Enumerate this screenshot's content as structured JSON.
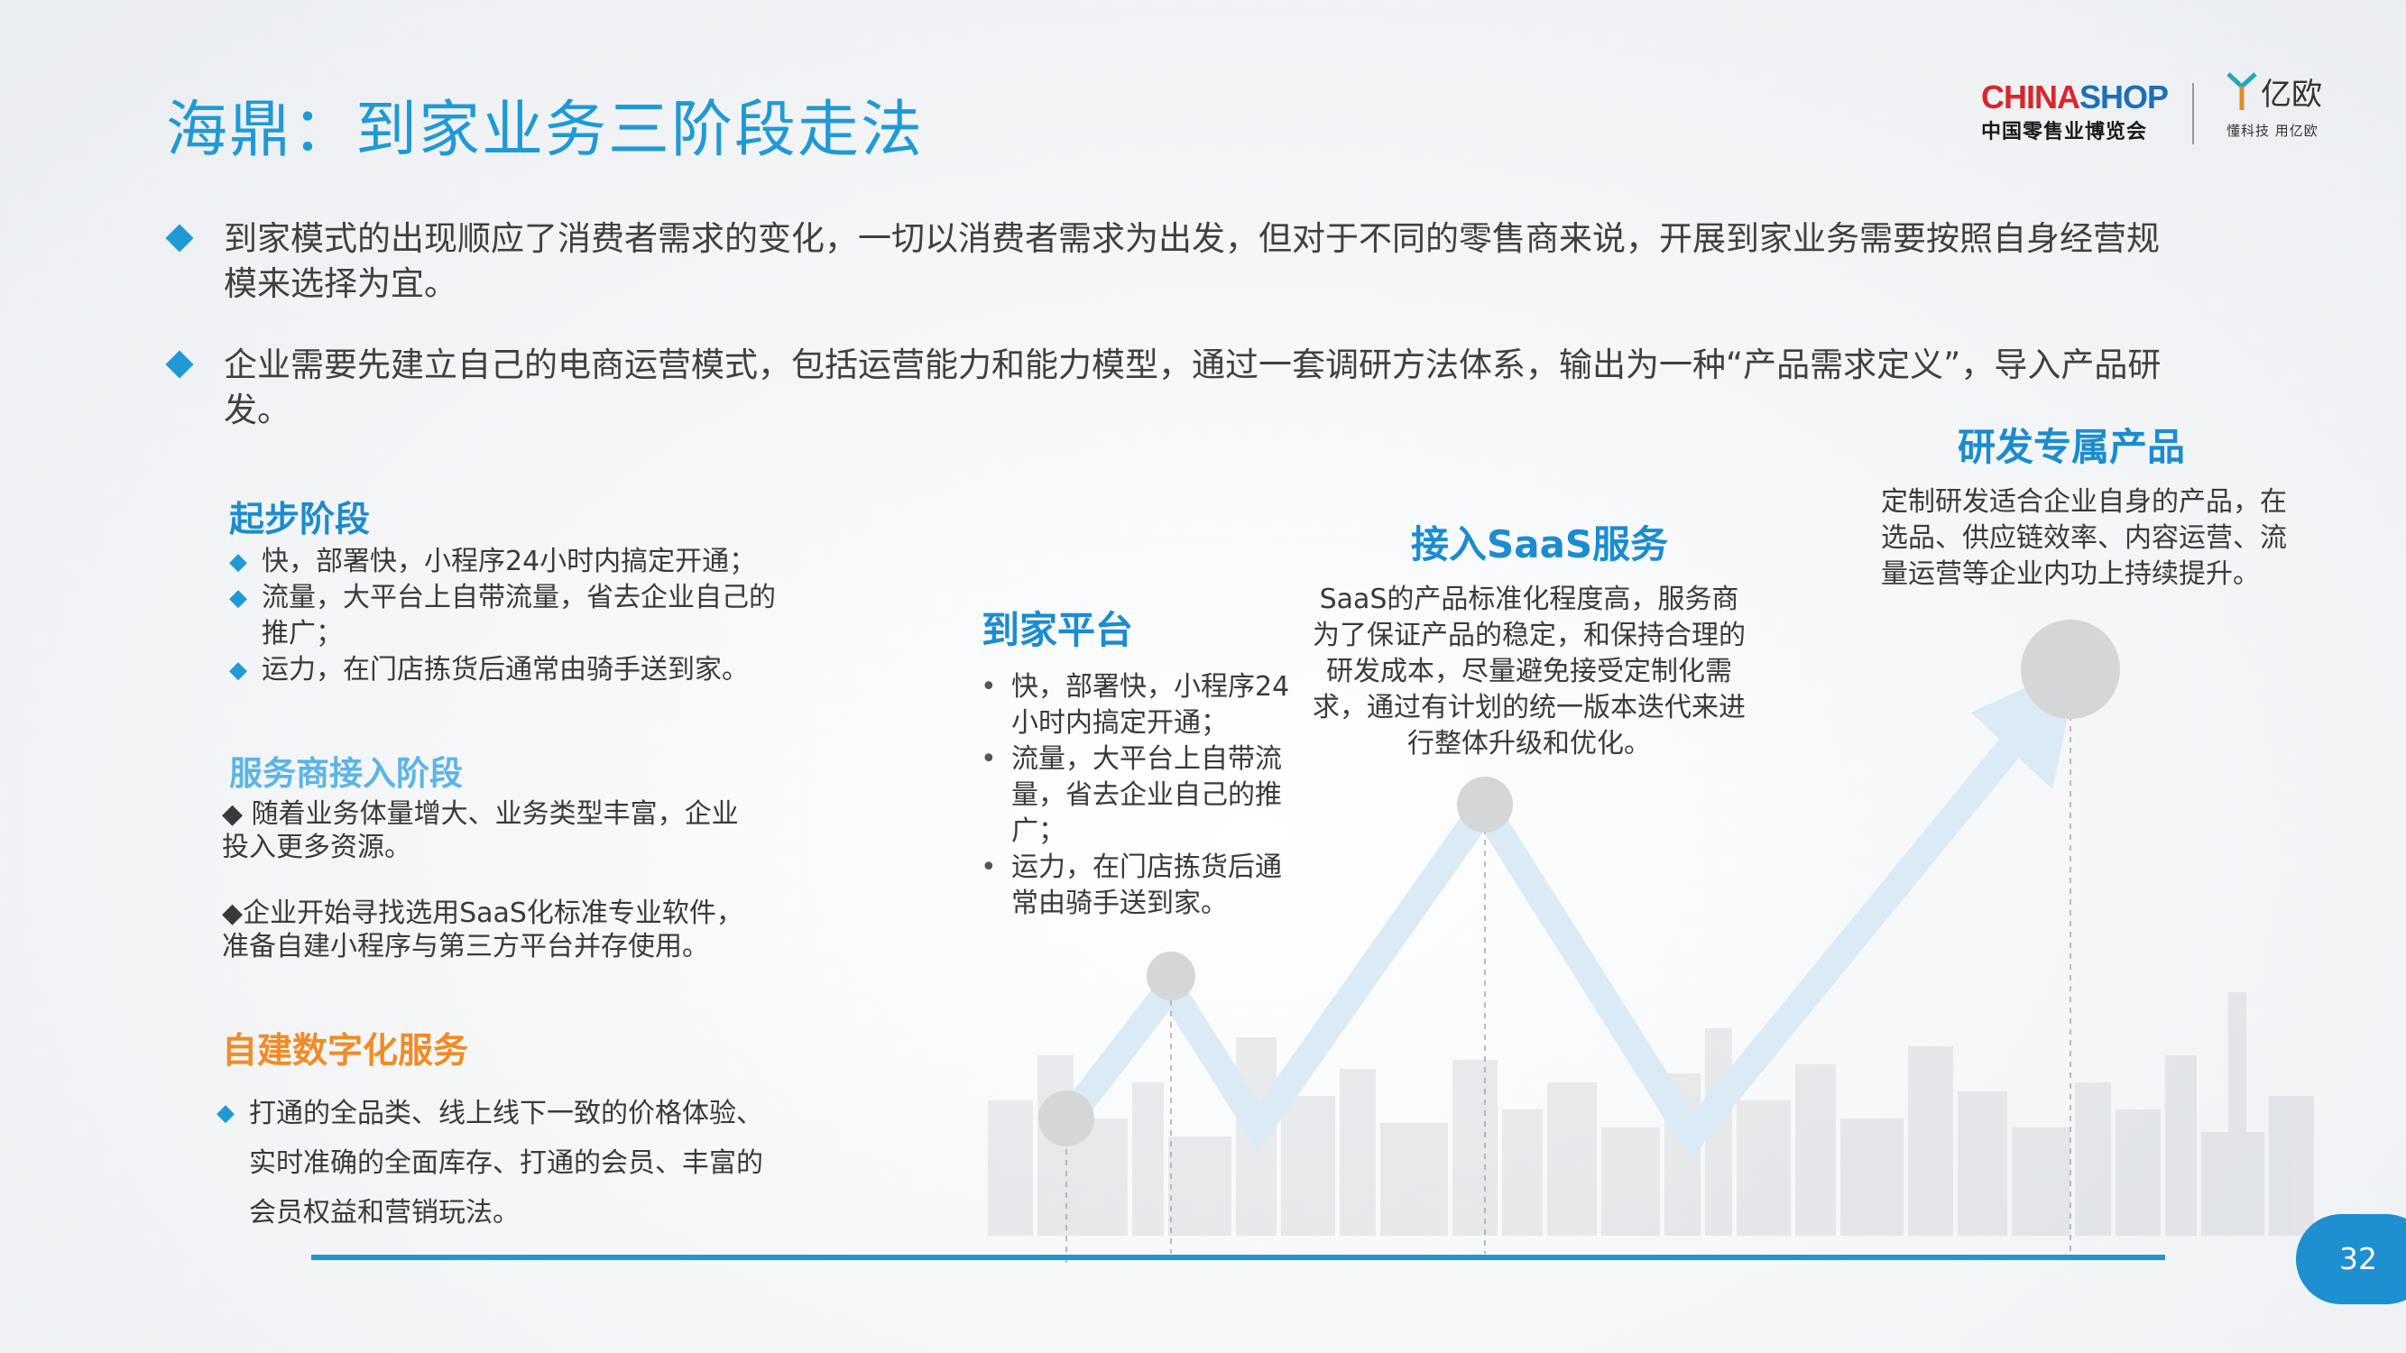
{
  "title": "海鼎：到家业务三阶段走法",
  "logos": {
    "chinashop_red": "CHINA",
    "chinashop_blue": "SHOP",
    "chinashop_sub": "中国零售业博览会",
    "yiou_name": "亿欧",
    "yiou_tagline": "懂科技 用亿欧"
  },
  "bullets": [
    "到家模式的出现顺应了消费者需求的变化，一切以消费者需求为出发，但对于不同的零售商来说，开展到家业务需要按照自身经营规模来选择为宜。",
    "企业需要先建立自己的电商运营模式，包括运营能力和能力模型，通过一套调研方法体系，输出为一种“产品需求定义”，导入产品研发。"
  ],
  "left": {
    "stage1": {
      "title": "起步阶段",
      "items": [
        "快，部署快，小程序24小时内搞定开通；",
        "流量，大平台上自带流量，省去企业自己的推广；",
        "运力，在门店拣货后通常由骑手送到家。"
      ]
    },
    "stage2": {
      "title": "服务商接入阶段",
      "p1": "◆ 随着业务体量增大、业务类型丰富，企业投入更多资源。",
      "p2": "◆企业开始寻找选用SaaS化标准专业软件，准备自建小程序与第三方平台并存使用。"
    },
    "stage3": {
      "title": "自建数字化服务",
      "text": "打通的全品类、线上线下一致的价格体验、实时准确的全面库存、打通的会员、丰富的会员权益和营销玩法。"
    }
  },
  "platform": {
    "title": "到家平台",
    "items": [
      "快，部署快，小程序24小时内搞定开通；",
      "流量，大平台上自带流量，省去企业自己的推广；",
      "运力，在门店拣货后通常由骑手送到家。"
    ]
  },
  "saas": {
    "title": "接入SaaS服务",
    "text": "SaaS的产品标准化程度高，服务商为了保证产品的稳定，和保持合理的研发成本，尽量避免接受定制化需求，通过有计划的统一版本迭代来进行整体升级和优化。"
  },
  "rd": {
    "title": "研发专属产品",
    "text": "定制研发适合企业自身的产品，在选品、供应链效率、内容运营、流量运营等企业内功上持续提升。"
  },
  "page_number": "32"
}
